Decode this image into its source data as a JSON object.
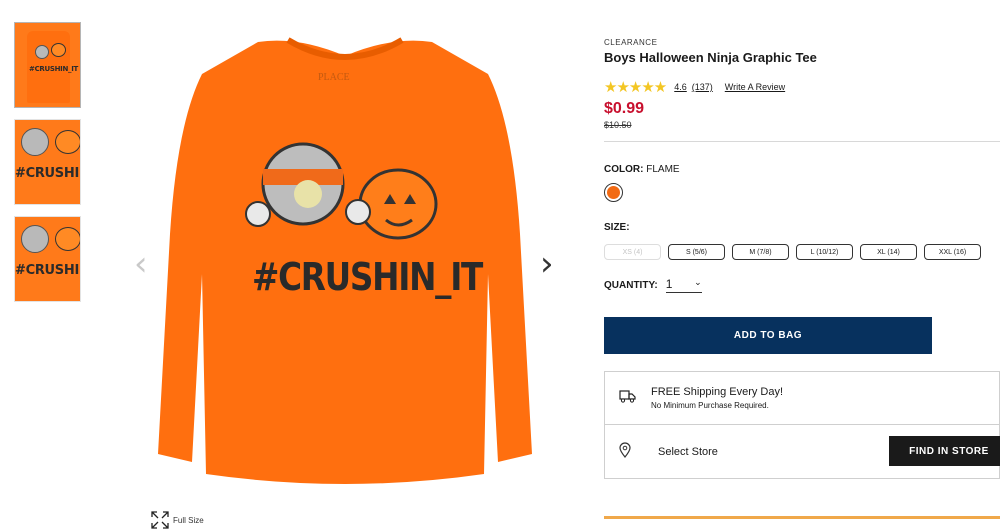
{
  "product": {
    "tag": "CLEARANCE",
    "title": "Boys Halloween Ninja Graphic Tee",
    "rating": "4.6",
    "review_count": "(137)",
    "write_review": "Write A Review",
    "price": "$0.99",
    "old_price": "$10.50",
    "stars_value": 4.6
  },
  "color": {
    "label": "COLOR:",
    "value": "FLAME",
    "swatch_hex": "#f26a13"
  },
  "size": {
    "label": "SIZE:",
    "options": [
      "XS (4)",
      "S (5/6)",
      "M (7/8)",
      "L (10/12)",
      "XL (14)",
      "XXL (16)"
    ]
  },
  "quantity": {
    "label": "QUANTITY:",
    "value": "1"
  },
  "add_to_bag": "ADD TO BAG",
  "shipping": {
    "title": "FREE Shipping Every Day!",
    "subtitle": "No Minimum Purchase Required."
  },
  "store": {
    "label": "Select Store",
    "button": "FIND IN STORE"
  },
  "gallery": {
    "graphic_text": "#CRUSHIN_IT",
    "neck_label": "PLACE",
    "full_size": "Full Size",
    "thumb_text": "#CRUSHIN_IT",
    "thumb_close_text": "#CRUSHIN_IT"
  },
  "colors": {
    "accent_navy": "#07315e",
    "price_red": "#c8102e",
    "star": "#f3c623",
    "shirt": "#ff6f0f"
  },
  "icons": [
    "expand-icon",
    "truck-icon",
    "map-pin-icon",
    "chevron-left-icon",
    "chevron-right-icon",
    "chevron-down-icon"
  ]
}
